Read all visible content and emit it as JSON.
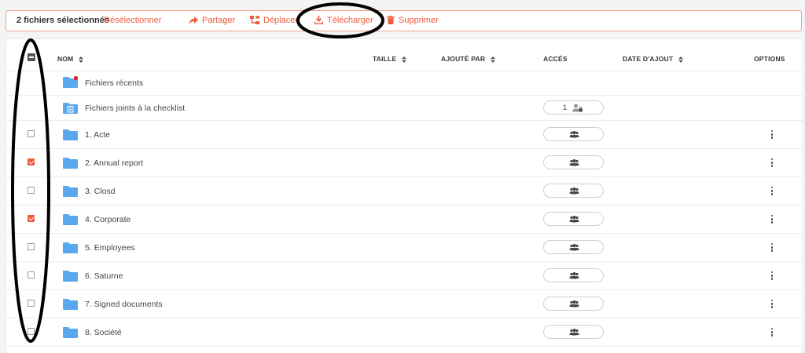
{
  "toolbar": {
    "selected_count": "2 fichiers sélectionnés",
    "unselect": "Désélectionner",
    "share": "Partager",
    "move": "Déplacer",
    "download": "Télécharger",
    "delete": "Supprimer"
  },
  "table": {
    "headers": {
      "name": "NOM",
      "size": "TAILLE",
      "added_by": "AJOUTÉ PAR",
      "access": "ACCÈS",
      "date_added": "DATE D'AJOUT",
      "options": "OPTIONS"
    },
    "special_rows": [
      {
        "name": "Fichiers récents"
      },
      {
        "name": "Fichiers joints à la checklist",
        "access_count": "1"
      }
    ],
    "rows": [
      {
        "name": "1. Acte",
        "checked": false
      },
      {
        "name": "2. Annual report",
        "checked": true
      },
      {
        "name": "3. Closd",
        "checked": false
      },
      {
        "name": "4. Corporate",
        "checked": true
      },
      {
        "name": "5. Employees",
        "checked": false
      },
      {
        "name": "6. Saturne",
        "checked": false
      },
      {
        "name": "7. Signed documents",
        "checked": false
      },
      {
        "name": "8. Société",
        "checked": false
      }
    ]
  },
  "colors": {
    "accent": "#ee5a3a",
    "folder": "#5aa7ee",
    "badge": "#e02020"
  }
}
